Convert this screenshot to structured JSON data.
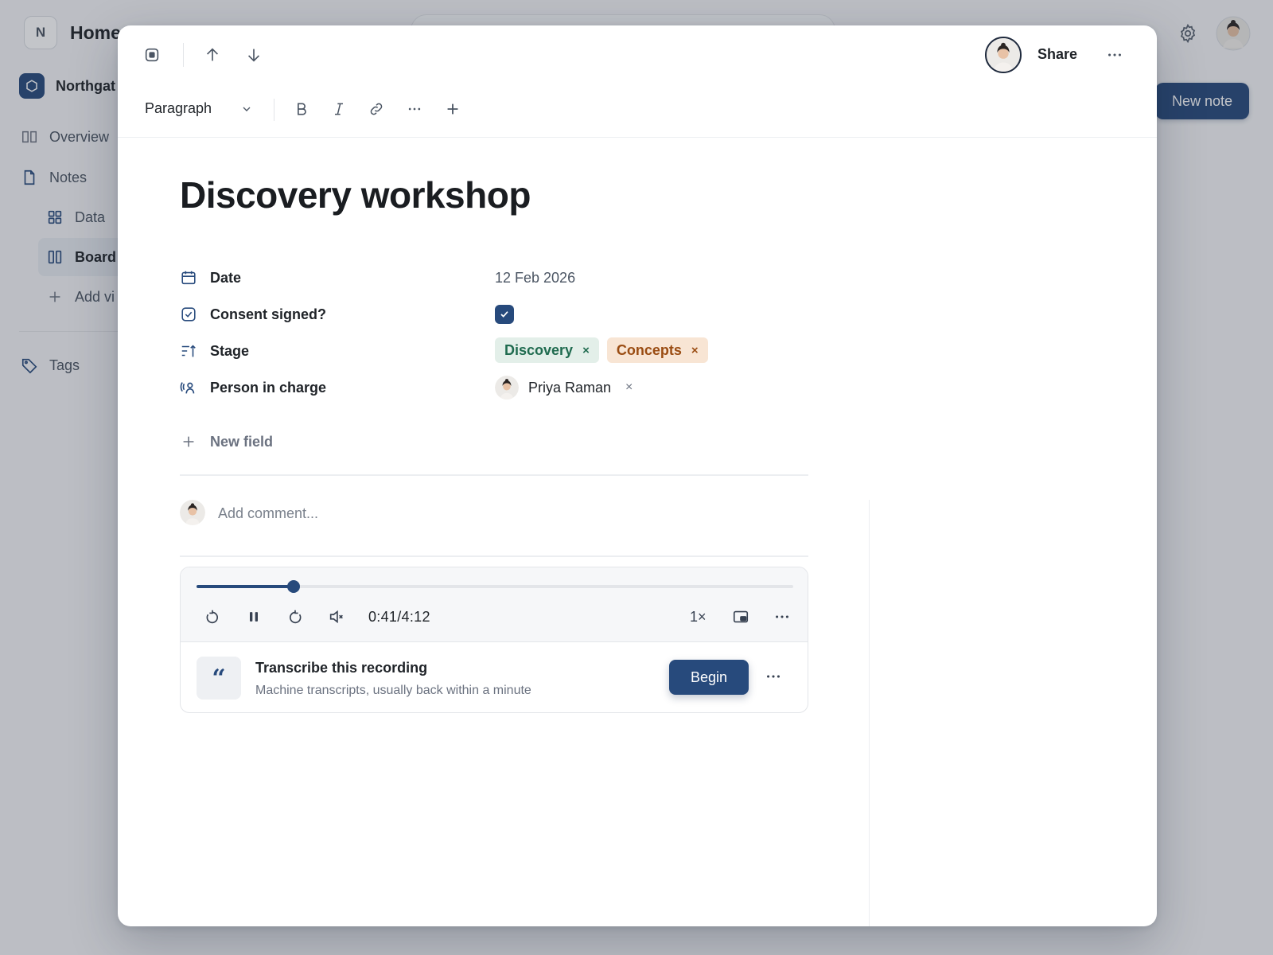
{
  "app": {
    "workspace_initial": "N",
    "page_title": "Home",
    "org_name": "Northgat",
    "nav": {
      "overview": "Overview",
      "notes": "Notes",
      "data": "Data",
      "board": "Board",
      "add_view": "Add vi",
      "tags": "Tags"
    },
    "new_note_label": "New note"
  },
  "modal": {
    "share_label": "Share",
    "format_select": "Paragraph",
    "title": "Discovery workshop",
    "properties": [
      {
        "label": "Date",
        "value": "12 Feb 2026"
      },
      {
        "label": "Consent signed?",
        "checked": true
      },
      {
        "label": "Stage",
        "tags": [
          {
            "text": "Discovery",
            "remove": "×",
            "color": "#1f6b4f",
            "bg": "#e3efe9"
          },
          {
            "text": "Concepts",
            "remove": "×",
            "color": "#9a4c12",
            "bg": "#f8e5d4"
          }
        ]
      },
      {
        "label": "Person in charge",
        "person": "Priya Raman",
        "remove": "×"
      }
    ],
    "new_field_label": "New field",
    "comment_placeholder": "Add comment...",
    "audio": {
      "progress": 0.163,
      "time_display": "0:41/4:12",
      "speed": "1×"
    },
    "transcribe": {
      "quote_glyph": "“",
      "title": "Transcribe this recording",
      "subtitle": "Machine transcripts, usually back within a minute",
      "button": "Begin"
    }
  },
  "colors": {
    "accent": "#274a7c",
    "tag_green_bg": "#e3efe9",
    "tag_orange_bg": "#f8e5d4"
  }
}
